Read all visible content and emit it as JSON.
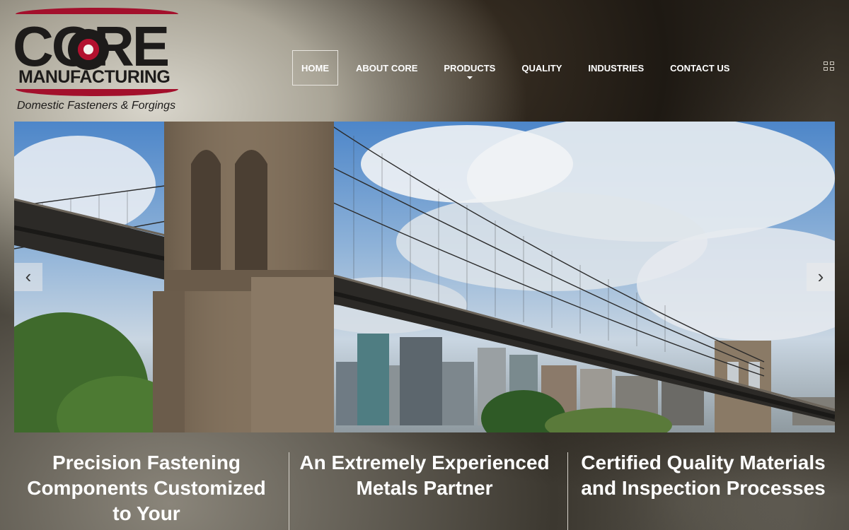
{
  "logo": {
    "core": "CORE",
    "manufacturing": "MANUFACTURING",
    "tagline": "Domestic Fasteners & Forgings"
  },
  "nav": {
    "items": [
      {
        "label": "HOME",
        "active": true
      },
      {
        "label": "ABOUT CORE"
      },
      {
        "label": "PRODUCTS",
        "has_dropdown": true
      },
      {
        "label": "QUALITY"
      },
      {
        "label": "INDUSTRIES"
      },
      {
        "label": "CONTACT US"
      }
    ],
    "menu_icon": "grid-icon"
  },
  "slider": {
    "prev_icon": "‹",
    "next_icon": "›"
  },
  "features": [
    {
      "text": "Precision Fastening Components Customized to Your"
    },
    {
      "text": "An Extremely Experienced Metals Partner"
    },
    {
      "text": "Certified Quality Materials and Inspection Processes"
    }
  ],
  "colors": {
    "brand_red": "#a3102c",
    "nav_text": "#ffffff"
  }
}
